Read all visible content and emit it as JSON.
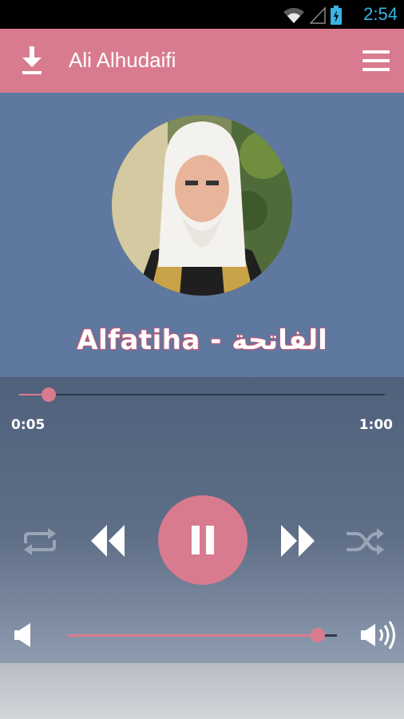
{
  "status_bar": {
    "time": "2:54"
  },
  "app_bar": {
    "title": "Ali Alhudaifi"
  },
  "track": {
    "title": "Alfatiha - الفاتحة"
  },
  "player": {
    "current_time": "0:05",
    "total_time": "1:00",
    "progress_fraction": 0.08,
    "volume_fraction": 0.93
  },
  "colors": {
    "accent": "#d97b8f",
    "hero_bg": "#5e78a0",
    "status_icon": "#39b4e5"
  },
  "icons": {
    "download": "download-icon",
    "menu": "hamburger-menu-icon",
    "repeat": "repeat-icon",
    "rewind": "rewind-icon",
    "pause": "pause-icon",
    "forward": "fast-forward-icon",
    "shuffle": "shuffle-icon",
    "volume_low": "volume-low-icon",
    "volume_high": "volume-high-icon",
    "wifi": "wifi-icon",
    "signal": "cell-signal-icon",
    "battery": "battery-charging-icon"
  }
}
